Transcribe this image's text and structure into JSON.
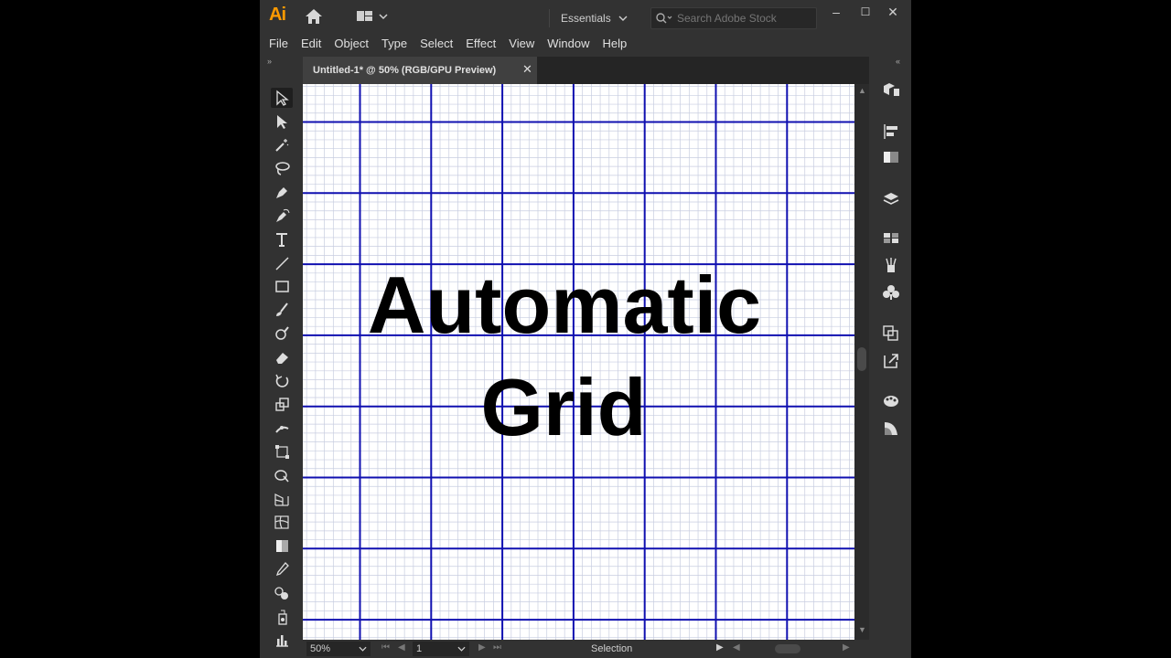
{
  "app": {
    "logo": "Ai",
    "workspace": "Essentials",
    "search": {
      "placeholder": "Search Adobe Stock",
      "value": ""
    },
    "window_controls": [
      "–",
      "☐",
      "✕"
    ]
  },
  "menu": [
    "File",
    "Edit",
    "Object",
    "Type",
    "Select",
    "Effect",
    "View",
    "Window",
    "Help"
  ],
  "document": {
    "tab_label": "Untitled-1* @ 50% (RGB/GPU Preview)",
    "close_glyph": "✕"
  },
  "canvas": {
    "line1": "Automatic",
    "line2": "Grid",
    "colors": {
      "major_grid": "#1010b0",
      "minor_grid": "#c8cde0",
      "text": "#000000",
      "background": "#ffffff"
    }
  },
  "status": {
    "zoom": "50%",
    "page": "1",
    "tool": "Selection"
  },
  "tools": [
    "selection-tool-icon",
    "direct-selection-tool-icon",
    "magic-wand-tool-icon",
    "lasso-tool-icon",
    "pen-tool-icon",
    "curvature-tool-icon",
    "type-tool-icon",
    "line-segment-tool-icon",
    "rectangle-tool-icon",
    "paintbrush-tool-icon",
    "shaper-tool-icon",
    "eraser-tool-icon",
    "rotate-tool-icon",
    "scale-tool-icon",
    "width-tool-icon",
    "free-transform-tool-icon",
    "shape-builder-tool-icon",
    "perspective-grid-tool-icon",
    "mesh-tool-icon",
    "gradient-tool-icon",
    "eyedropper-tool-icon",
    "blend-tool-icon",
    "symbol-sprayer-tool-icon",
    "column-graph-tool-icon"
  ],
  "right_panels": [
    "libraries-icon",
    "align-icon",
    "gradient-panel-icon",
    "layers-icon",
    "swatches-icon",
    "brushes-icon",
    "symbols-icon",
    "transform-icon",
    "export-icon",
    "color-themes-icon",
    "transparency-icon"
  ]
}
